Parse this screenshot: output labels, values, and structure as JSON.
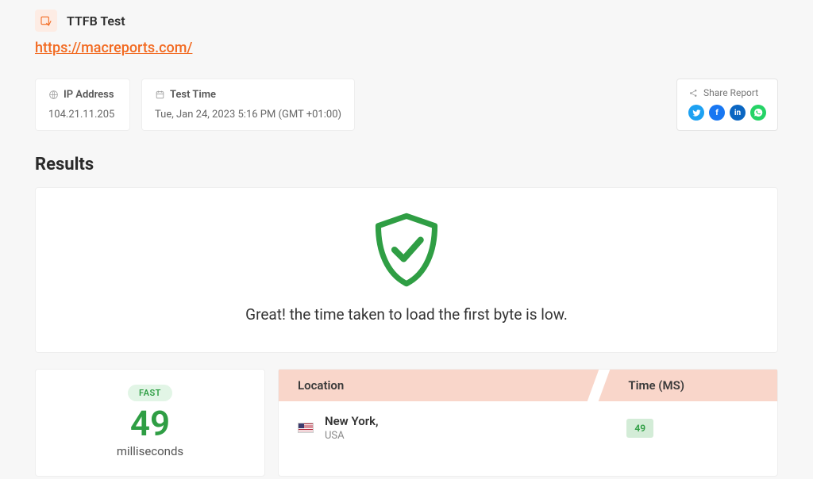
{
  "header": {
    "title": "TTFB Test",
    "url": "https://macreports.com/"
  },
  "info": {
    "ip_label": "IP Address",
    "ip_value": "104.21.11.205",
    "time_label": "Test Time",
    "time_value": "Tue, Jan 24, 2023 5:16 PM (GMT +01:00)"
  },
  "share": {
    "label": "Share Report"
  },
  "results": {
    "heading": "Results",
    "message": "Great! the time taken to load the first byte is low."
  },
  "speed": {
    "badge": "FAST",
    "value": "49",
    "unit": "milliseconds"
  },
  "table": {
    "col_location": "Location",
    "col_time": "Time (MS)",
    "rows": [
      {
        "city": "New York,",
        "country": "USA",
        "ms": "49"
      }
    ]
  }
}
